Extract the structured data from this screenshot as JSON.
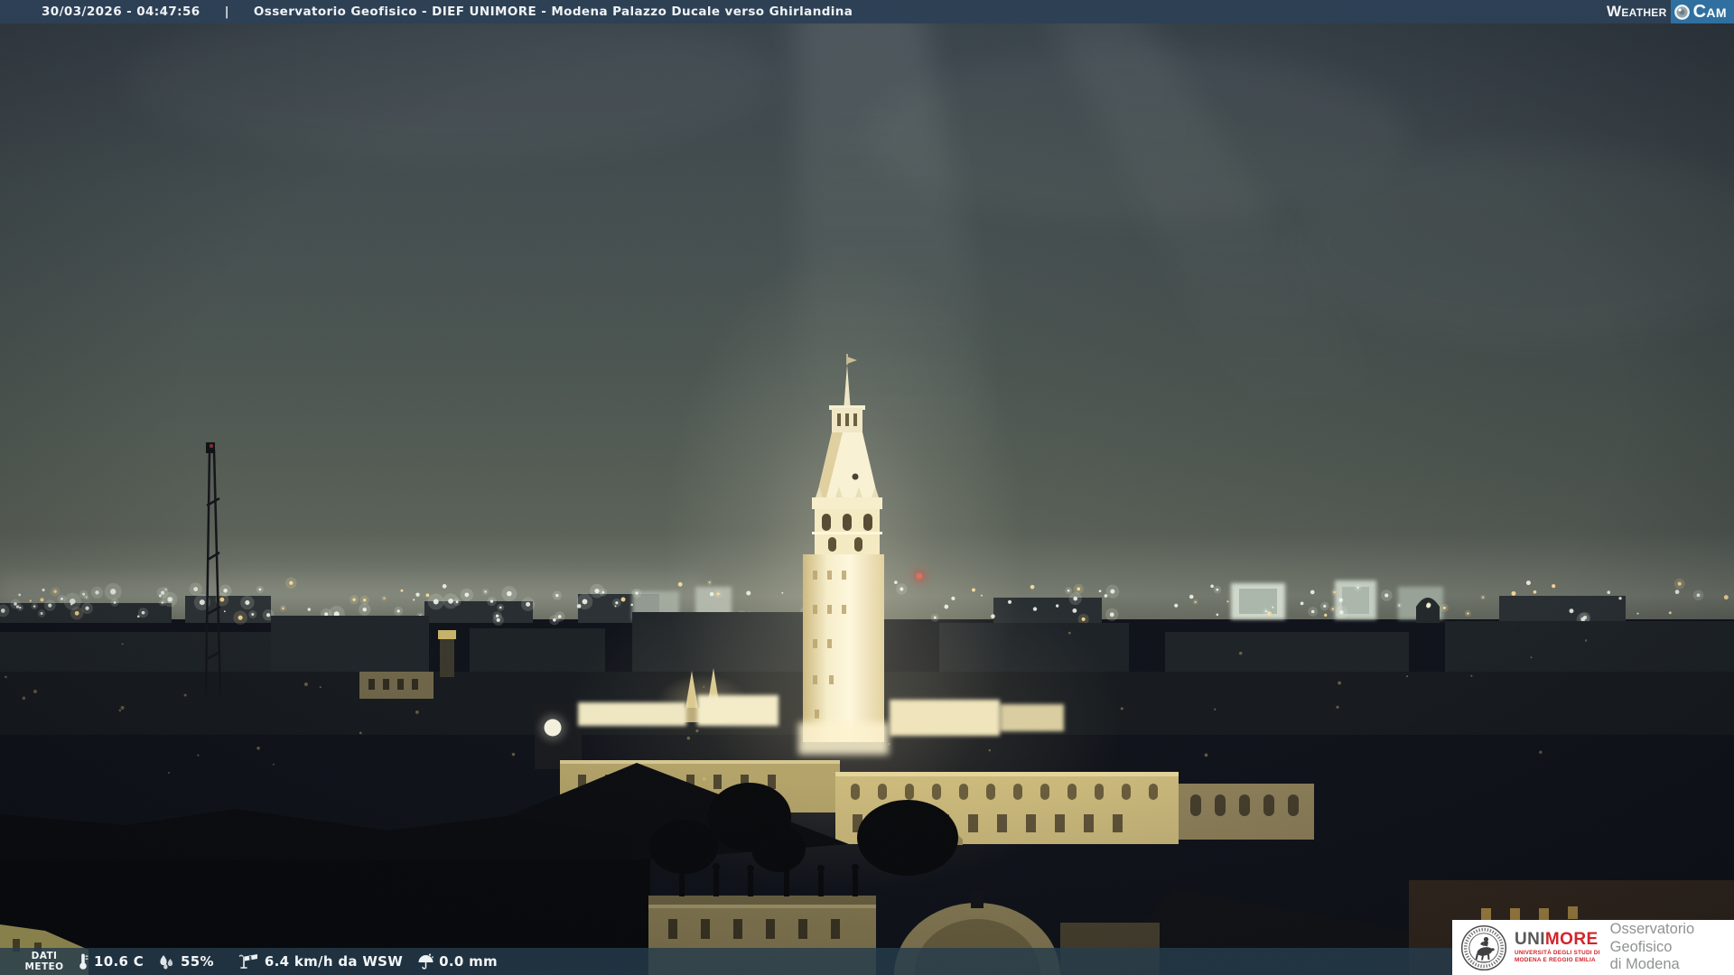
{
  "header": {
    "timestamp": "30/03/2026 - 04:47:56",
    "separator": "|",
    "title": "Osservatorio Geofisico - DIEF UNIMORE - Modena Palazzo Ducale verso Ghirlandina",
    "logo": {
      "weather": "Weather",
      "cam": "Cam"
    }
  },
  "footer": {
    "label_line1": "DATI",
    "label_line2": "METEO",
    "temperature": "10.6 C",
    "humidity": "55%",
    "wind": "6.4 km/h da WSW",
    "rain": "0.0 mm"
  },
  "branding": {
    "unimore_prefix": "UNI",
    "unimore_suffix": "MORE",
    "university_line1": "UNIVERSITÀ DEGLI STUDI DI",
    "university_line2": "MODENA E REGGIO EMILIA",
    "observatory_line1": "Osservatorio Geofisico",
    "observatory_line2": "di Modena"
  },
  "colors": {
    "header_bar": "#2c3f54",
    "footer_bar": "#263b4a",
    "cam_box_blue": "#2e6f9f",
    "unimore_red": "#d2232a",
    "unimore_gray": "#58585a",
    "observatory_text_gray": "#8e9193"
  }
}
